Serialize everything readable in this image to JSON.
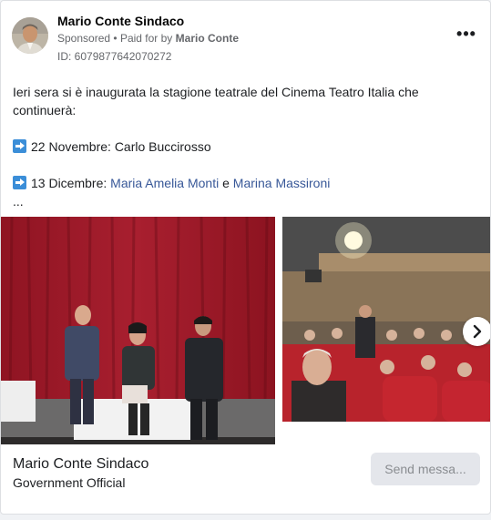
{
  "post": {
    "page_name": "Mario Conte Sindaco",
    "sponsored_label": "Sponsored",
    "separator": "•",
    "paid_for_label": "Paid for by",
    "paid_for_name": "Mario Conte",
    "ad_id": "ID: 6079877642070272",
    "more_icon": "more-horizontal-icon",
    "more_label": "•••",
    "text": {
      "line1": "Ieri sera si è inaugurata la stagione teatrale del Cinema Teatro Italia che continuerà:",
      "event1_icon": "right-arrow-emoji",
      "event1": "22 Novembre: Carlo Buccirosso",
      "event2_icon": "right-arrow-emoji",
      "event2_prefix": "13 Dicembre:",
      "event2_mention1": "Maria Amelia Monti",
      "event2_conj": "e",
      "event2_mention2": "Marina Massironi",
      "truncation": "..."
    },
    "carousel": {
      "slides": [
        {
          "description": "stage-photo",
          "alt": "Speakers on theatre stage"
        },
        {
          "description": "audience-photo",
          "alt": "Audience in theatre"
        }
      ],
      "next_icon": "chevron-right-icon"
    },
    "footer": {
      "title": "Mario Conte Sindaco",
      "subtitle": "Government Official",
      "cta_label": "Send messa..."
    }
  },
  "colors": {
    "link": "#385898",
    "muted": "#65676b",
    "button_bg": "#e4e6eb",
    "curtain": "#9d1b2a",
    "seat": "#b8232c"
  }
}
